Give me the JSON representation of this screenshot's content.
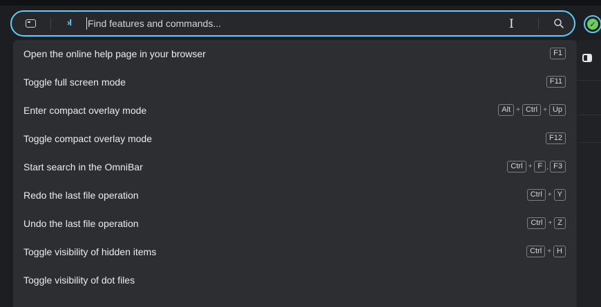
{
  "omnibar": {
    "placeholder": "Find features and commands...",
    "mode_icon": "command-palette-icon",
    "chevron": "›I",
    "search_icon": "search-icon",
    "accent": "#60cdff"
  },
  "status": {
    "icon": "checkmark-icon",
    "color": "#6ccb5f"
  },
  "commands": [
    {
      "label": "Open the online help page in your browser",
      "keys": [
        "F1"
      ]
    },
    {
      "label": "Toggle full screen mode",
      "keys": [
        "F11"
      ]
    },
    {
      "label": "Enter compact overlay mode",
      "keys": [
        "Alt",
        "+",
        "Ctrl",
        "+",
        "Up"
      ]
    },
    {
      "label": "Toggle compact overlay mode",
      "keys": [
        "F12"
      ]
    },
    {
      "label": "Start search in the OmniBar",
      "keys": [
        "Ctrl",
        "+",
        "F",
        ",",
        "F3"
      ]
    },
    {
      "label": "Redo the last file operation",
      "keys": [
        "Ctrl",
        "+",
        "Y"
      ]
    },
    {
      "label": "Undo the last file operation",
      "keys": [
        "Ctrl",
        "+",
        "Z"
      ]
    },
    {
      "label": "Toggle visibility of hidden items",
      "keys": [
        "Ctrl",
        "+",
        "H"
      ]
    },
    {
      "label": "Toggle visibility of dot files",
      "keys": []
    }
  ]
}
